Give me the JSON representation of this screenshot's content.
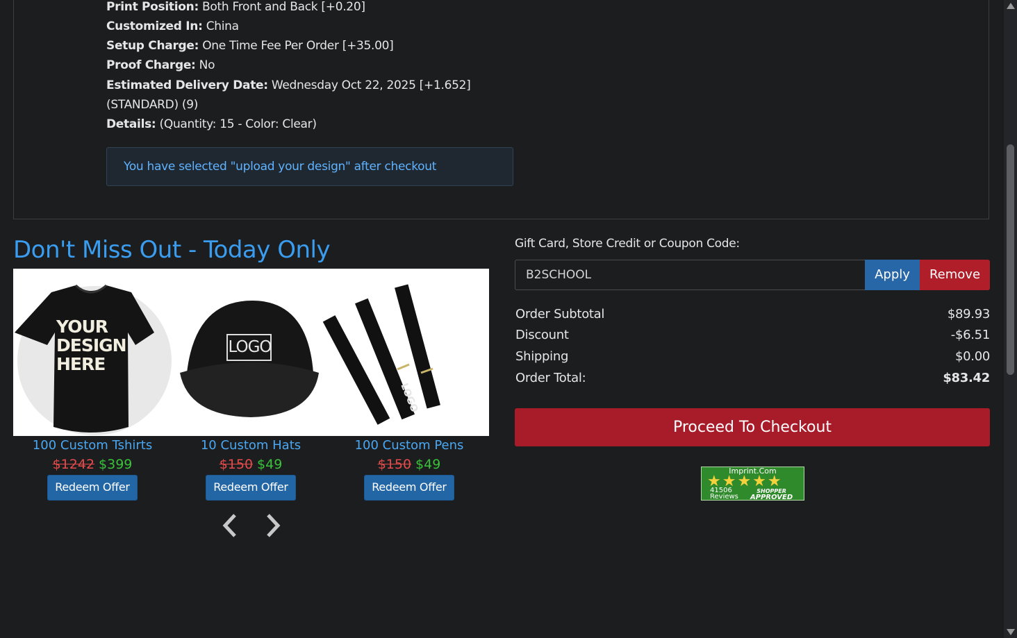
{
  "order_details": {
    "print_position_label": "Print Position:",
    "print_position_value": " Both Front and Back [+0.20]",
    "customized_in_label": "Customized In:",
    "customized_in_value": " China",
    "setup_charge_label": "Setup Charge:",
    "setup_charge_value": " One Time Fee Per Order [+35.00]",
    "proof_charge_label": "Proof Charge:",
    "proof_charge_value": " No",
    "delivery_label": "Estimated Delivery Date:",
    "delivery_value": " Wednesday Oct 22, 2025 [+1.652]",
    "delivery_value_line2": "(STANDARD) (9)",
    "details_label": "Details:",
    "details_value": " (Quantity: 15 - Color: Clear)",
    "notice": "You have selected \"upload your design\" after checkout"
  },
  "promo": {
    "title": "Don't Miss Out - Today Only",
    "offers": [
      {
        "name": "100 Custom Tshirts",
        "old_price": "$1242",
        "new_price": "$399",
        "button": "Redeem Offer",
        "image": "tshirt"
      },
      {
        "name": "10 Custom Hats",
        "old_price": "$150",
        "new_price": "$49",
        "button": "Redeem Offer",
        "image": "hat"
      },
      {
        "name": "100 Custom Pens",
        "old_price": "$150",
        "new_price": "$49",
        "button": "Redeem Offer",
        "image": "pens"
      }
    ],
    "tshirt_print": [
      "YOUR",
      "DESIGN",
      "HERE"
    ],
    "hat_print": "LOGO",
    "pen_print": "LOGO",
    "prev_icon": "chevron-left-icon",
    "next_icon": "chevron-right-icon"
  },
  "coupon": {
    "label": "Gift Card, Store Credit or Coupon Code:",
    "value": "B2SCHOOL",
    "apply": "Apply",
    "remove": "Remove"
  },
  "summary": {
    "subtotal_label": "Order Subtotal",
    "subtotal_value": "$89.93",
    "discount_label": "Discount",
    "discount_value": "-$6.51",
    "shipping_label": "Shipping",
    "shipping_value": "$0.00",
    "total_label": "Order Total:",
    "total_value": "$83.42"
  },
  "checkout_button": "Proceed To Checkout",
  "badge": {
    "site": "Imprint.Com",
    "stars": "★★★★★",
    "reviews_count": "41506",
    "reviews_label": "Reviews",
    "shopper": "SHOPPER",
    "approved": "APPROVED"
  },
  "colors": {
    "background": "#1c1d1f",
    "accent_blue": "#3a9df0",
    "apply_blue": "#2767a8",
    "danger_red": "#b01e2a",
    "price_green": "#39c23a"
  }
}
